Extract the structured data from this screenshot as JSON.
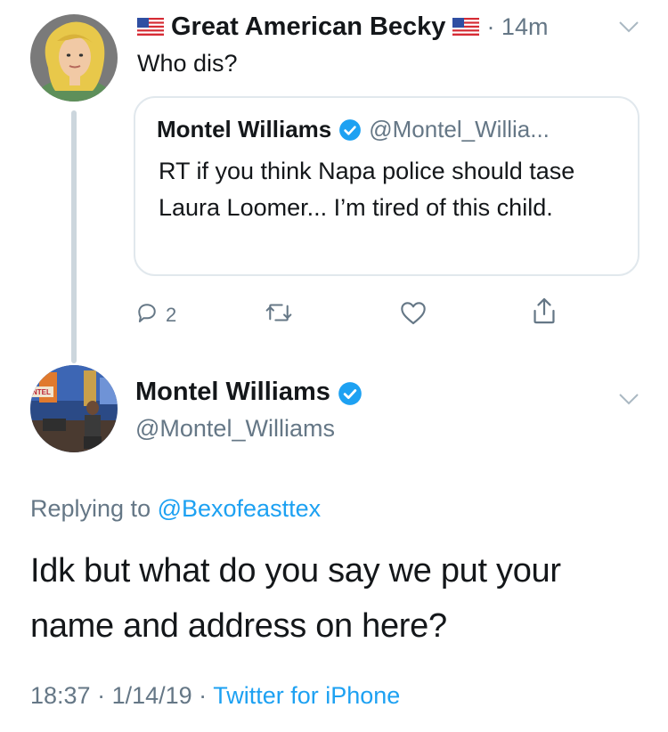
{
  "tweet": {
    "author_name": "Great American Becky",
    "time_ago": "· 14m",
    "text": "Who dis?",
    "quoted": {
      "author_name": "Montel Williams",
      "handle": "@Montel_Willia...",
      "text": "RT if you think Napa police should tase Laura Loomer... I’m tired of this child."
    },
    "actions": {
      "reply_count": "2"
    }
  },
  "reply": {
    "author_name": "Montel Williams",
    "handle": "@Montel_Williams",
    "replying_prefix": "Replying to ",
    "replying_to": "@Bexofeasttex",
    "text": "Idk but what do you say we put your name and address on here?",
    "time": "18:37",
    "date": "1/14/19",
    "source": "Twitter for iPhone"
  },
  "colors": {
    "link_blue": "#1da1f2",
    "secondary_gray": "#657786",
    "verified_blue": "#1da1f2",
    "border": "#e1e8ed"
  },
  "icons": [
    "us-flag-icon",
    "chevron-down-icon",
    "verified-badge-icon",
    "reply-icon",
    "retweet-icon",
    "like-icon",
    "share-icon"
  ]
}
